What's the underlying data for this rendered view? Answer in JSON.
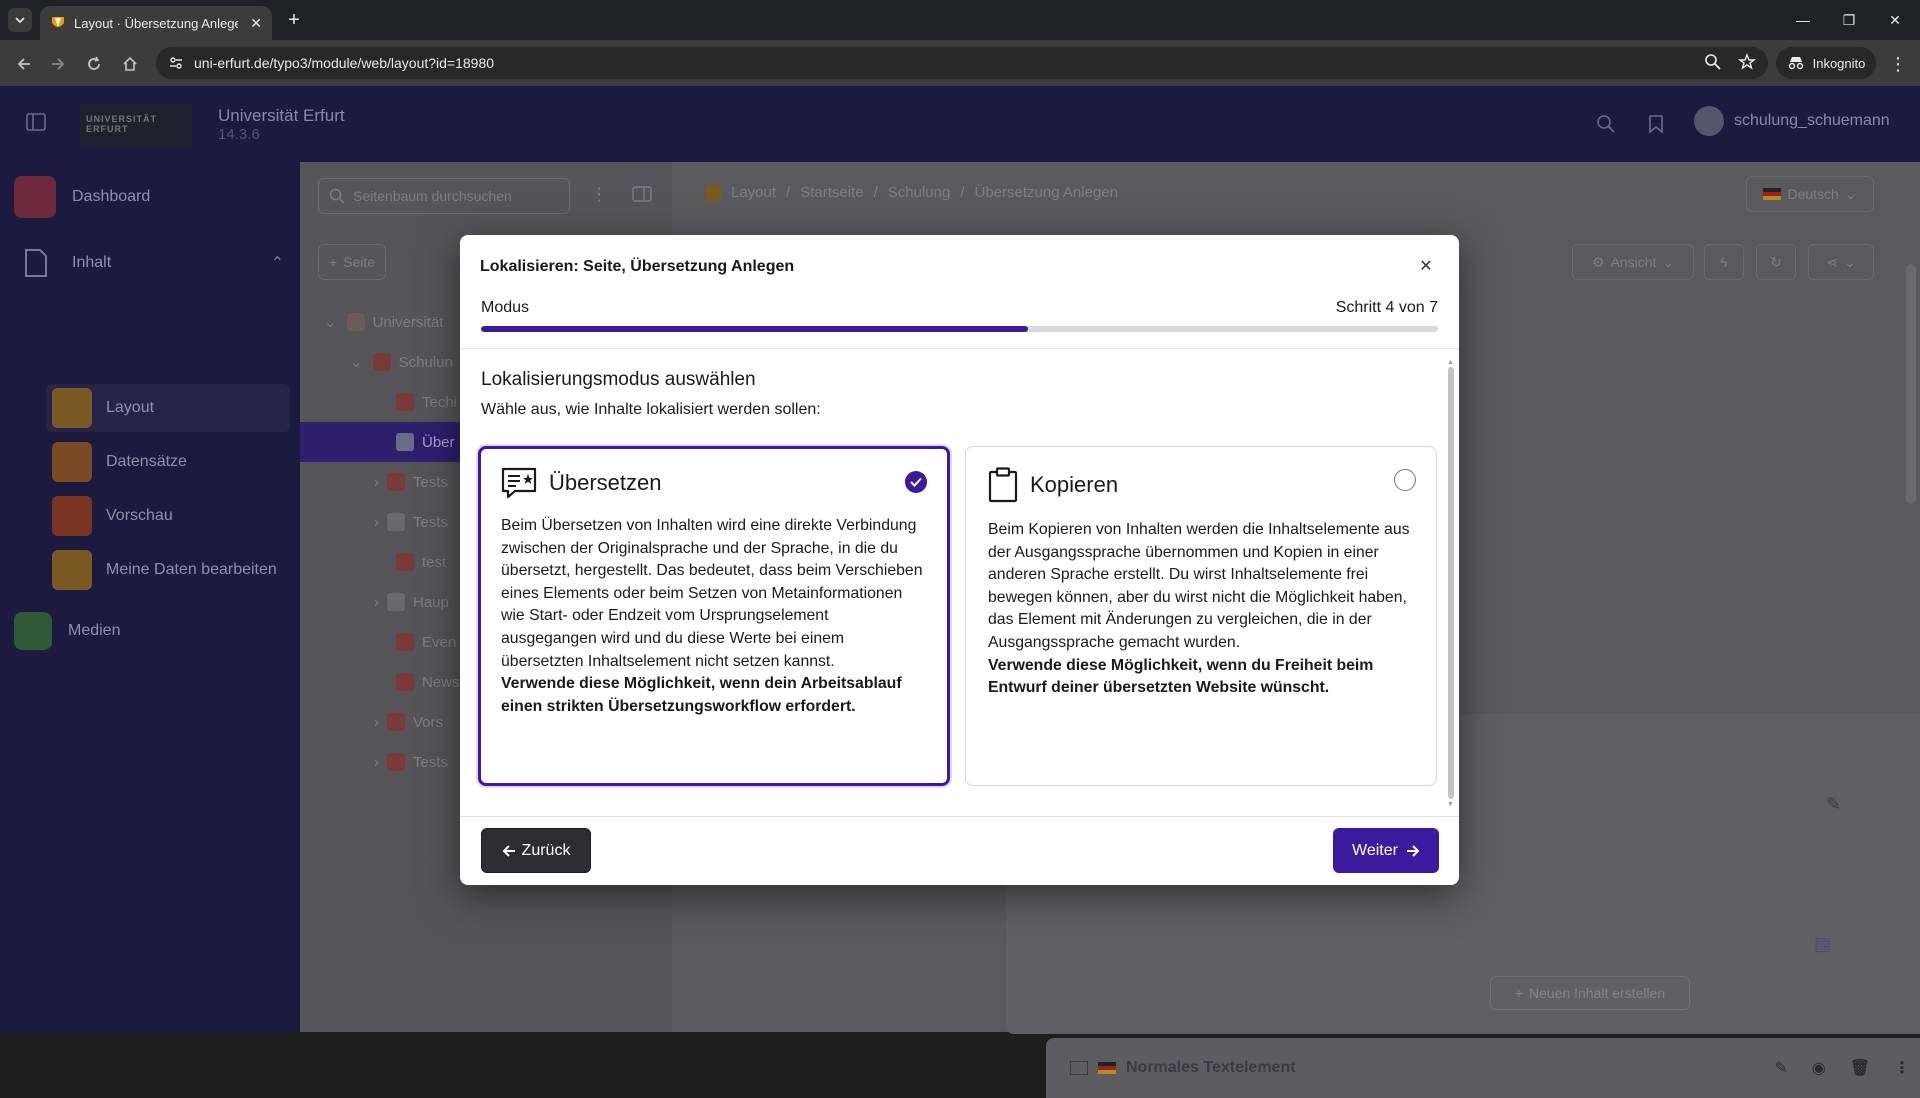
{
  "browser": {
    "tab_title": "Layout · Übersetzung Anlegen",
    "url": "uni-erfurt.de/typo3/module/web/layout?id=18980",
    "incognito_label": "Inkognito"
  },
  "backend": {
    "logo_text": "UNIVERSITÄT ERFURT",
    "site_name": "Universität Erfurt",
    "version": "14.3.6",
    "username": "schulung_schuemann",
    "modules": [
      {
        "label": "Dashboard"
      },
      {
        "label": "Inhalt"
      },
      {
        "label": "Layout"
      },
      {
        "label": "Datensätze"
      },
      {
        "label": "Vorschau"
      },
      {
        "label": "Meine Daten bearbeiten"
      },
      {
        "label": "Medien"
      }
    ],
    "tree_search_placeholder": "Seitenbaum durchsuchen",
    "tree_new_page": "Seite",
    "tree_items": [
      "Universität",
      "Schulun",
      "Techi",
      "Über",
      "Tests",
      "Tests",
      "test",
      "Haup",
      "Even",
      "News",
      "Vors",
      "Tests"
    ],
    "breadcrumb": [
      "Layout",
      "Startseite",
      "Schulung",
      "Übersetzung Anlegen"
    ],
    "language": "Deutsch",
    "view_button": "Ansicht",
    "new_content_button": "Neuen Inhalt erstellen",
    "content_element_title": "Normales Textelement"
  },
  "modal": {
    "title": "Lokalisieren: Seite, Übersetzung Anlegen",
    "progress": {
      "label": "Modus",
      "step_text": "Schritt 4 von 7",
      "current": 4,
      "total": 7
    },
    "heading": "Lokalisierungsmodus auswählen",
    "subheading": "Wähle aus, wie Inhalte lokalisiert werden sollen:",
    "options": [
      {
        "title": "Übersetzen",
        "icon": "translate-icon",
        "selected": true,
        "description": "Beim Übersetzen von Inhalten wird eine direkte Verbindung zwischen der Originalsprache und der Sprache, in die du übersetzt, hergestellt. Das bedeutet, dass beim Verschieben eines Elements oder beim Setzen von Metainformationen wie Start- oder Endzeit vom Ursprungselement ausgegangen wird und du diese Werte bei einem übersetzten Inhaltselement nicht setzen kannst.",
        "recommendation": "Verwende diese Möglichkeit, wenn dein Arbeitsablauf einen strikten Übersetzungsworkflow erfordert."
      },
      {
        "title": "Kopieren",
        "icon": "clipboard-icon",
        "selected": false,
        "description": "Beim Kopieren von Inhalten werden die Inhaltselemente aus der Ausgangssprache übernommen und Kopien in einer anderen Sprache erstellt. Du wirst Inhaltselemente frei bewegen können, aber du wirst nicht die Möglichkeit haben, das Element mit Änderungen zu vergleichen, die in der Ausgangssprache gemacht wurden.",
        "recommendation": "Verwende diese Möglichkeit, wenn du Freiheit beim Entwurf deiner übersetzten Website wünscht."
      }
    ],
    "back_label": "Zurück",
    "next_label": "Weiter"
  },
  "colors": {
    "accent": "#3c1a9e",
    "backend_dark": "#1c1a3e"
  }
}
